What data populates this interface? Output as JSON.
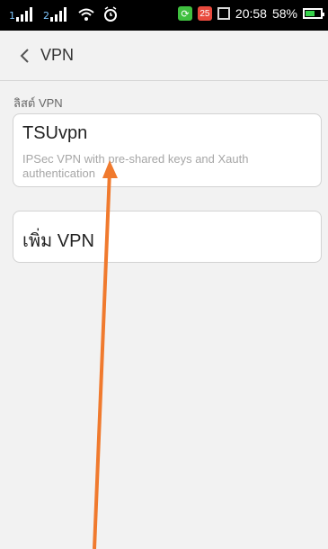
{
  "status_bar": {
    "time": "20:58",
    "battery": "58%",
    "notification_count": "25",
    "icons": [
      "signal-icon",
      "signal-icon",
      "wifi-icon",
      "alarm-icon",
      "app-notification-icon",
      "notification-count-icon",
      "image-notification-icon",
      "battery-icon"
    ]
  },
  "header": {
    "title": "VPN",
    "back_icon": "chevron-left-icon"
  },
  "vpn_list": {
    "section_label": "ลิสต์ VPN",
    "items": [
      {
        "name": "TSUvpn",
        "description": "IPSec VPN with pre-shared keys and Xauth authentication"
      }
    ]
  },
  "add_vpn": {
    "label": "เพิ่ม VPN"
  },
  "colors": {
    "background": "#f2f2f2",
    "card": "#ffffff",
    "arrow": "#f07a2e"
  }
}
